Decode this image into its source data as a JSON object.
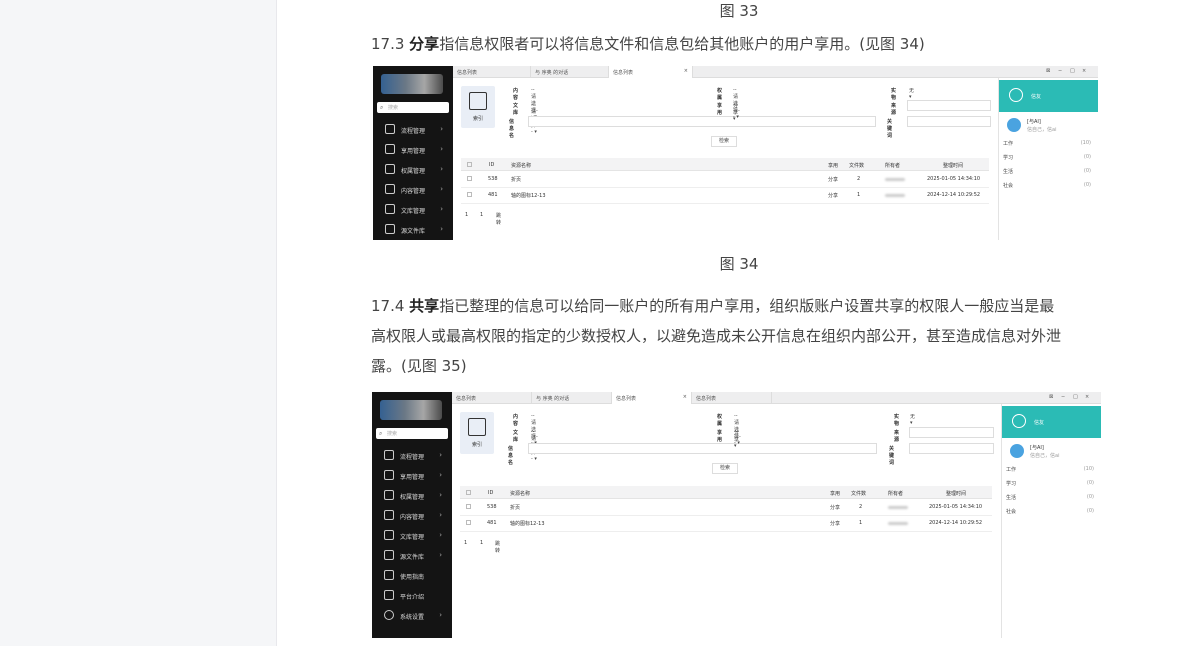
{
  "doc": {
    "caption_33": "图 33",
    "p173_num": "17.3 ",
    "p173_bold": "分享",
    "p173_rest": "指信息权限者可以将信息文件和信息包给其他账户的用户享用。(见图 34)",
    "caption_34": "图 34",
    "p174_num": "17.4  ",
    "p174_bold": "共享",
    "p174_line1": "指已整理的信息可以给同一账户的所有用户享用，组织版账户设置共享的权限人一般应当是最",
    "p174_line2": "高权限人或最高权限的指定的少数授权人，以避免造成未公开信息在组织内部公开，甚至造成信息对外泄",
    "p174_line3": "露。(见图 35)"
  },
  "shot1": {
    "search_placeholder": "搜索",
    "nav": [
      "流程管理",
      "享用管理",
      "权属管理",
      "内容管理",
      "文库管理",
      "源文件库"
    ],
    "tabs": [
      "信息列表",
      "与 序奥 的对话",
      "信息列表"
    ],
    "close_icon": "×",
    "win_controls": [
      "⊠",
      "−",
      "□",
      "×"
    ],
    "index_label": "索引",
    "f_content": "内容",
    "f_content_val": "--请选择--",
    "f_library": "文库",
    "f_library_val": "--请选择--",
    "f_name": "信息名",
    "f_owner": "权属",
    "f_owner_val": "--请选择--",
    "f_share": "享用",
    "f_share_val": "分享",
    "f_entity": "实物",
    "f_entity_val": "无",
    "f_source": "来源",
    "f_keyword": "关键词",
    "search_btn": "检索",
    "headers": [
      "ID",
      "资源名称",
      "享用",
      "文件数",
      "所有者",
      "整理时间"
    ],
    "rows": [
      {
        "id": "538",
        "name": "折页",
        "share": "分享",
        "count": "2",
        "time": "2025-01-05 14:34:10"
      },
      {
        "id": "481",
        "name": "轴的图标12-13",
        "share": "分享",
        "count": "1",
        "time": "2024-12-14 10:29:52"
      }
    ],
    "pager": [
      "1",
      "1",
      "跳转"
    ],
    "panel_title": "信友",
    "bot_name": "[与AI]",
    "bot_sub": "信自己，信ai",
    "groups": [
      {
        "name": "工作",
        "count": "(10)"
      },
      {
        "name": "学习",
        "count": "(0)"
      },
      {
        "name": "生活",
        "count": "(0)"
      },
      {
        "name": "社会",
        "count": "(0)"
      }
    ]
  },
  "shot2": {
    "search_placeholder": "搜索",
    "nav": [
      "流程管理",
      "享用管理",
      "权属管理",
      "内容管理",
      "文库管理",
      "源文件库",
      "使用指南",
      "平台介绍",
      "系统设置"
    ],
    "tabs": [
      "信息列表",
      "与 序奥 的对话",
      "信息列表",
      "信息列表"
    ],
    "close_icon": "×",
    "win_controls": [
      "⊠",
      "−",
      "□",
      "×"
    ],
    "index_label": "索引",
    "f_content": "内容",
    "f_content_val": "--请选择--",
    "f_library": "文库",
    "f_library_val": "--请选择--",
    "f_name": "信息名",
    "f_owner": "权属",
    "f_owner_val": "--请选择--",
    "f_share": "享用",
    "f_share_val": "分享",
    "f_entity": "实物",
    "f_entity_val": "无",
    "f_source": "来源",
    "f_keyword": "关键词",
    "search_btn": "检索",
    "headers": [
      "ID",
      "资源名称",
      "享用",
      "文件数",
      "所有者",
      "整理时间"
    ],
    "rows": [
      {
        "id": "538",
        "name": "折页",
        "share": "分享",
        "count": "2",
        "time": "2025-01-05 14:34:10"
      },
      {
        "id": "481",
        "name": "轴的图标12-13",
        "share": "分享",
        "count": "1",
        "time": "2024-12-14 10:29:52"
      }
    ],
    "pager": [
      "1",
      "1",
      "跳转"
    ],
    "panel_title": "信友",
    "bot_name": "[与AI]",
    "bot_sub": "信自己，信ai",
    "groups": [
      {
        "name": "工作",
        "count": "(10)"
      },
      {
        "name": "学习",
        "count": "(0)"
      },
      {
        "name": "生活",
        "count": "(0)"
      },
      {
        "name": "社会",
        "count": "(0)"
      }
    ]
  }
}
